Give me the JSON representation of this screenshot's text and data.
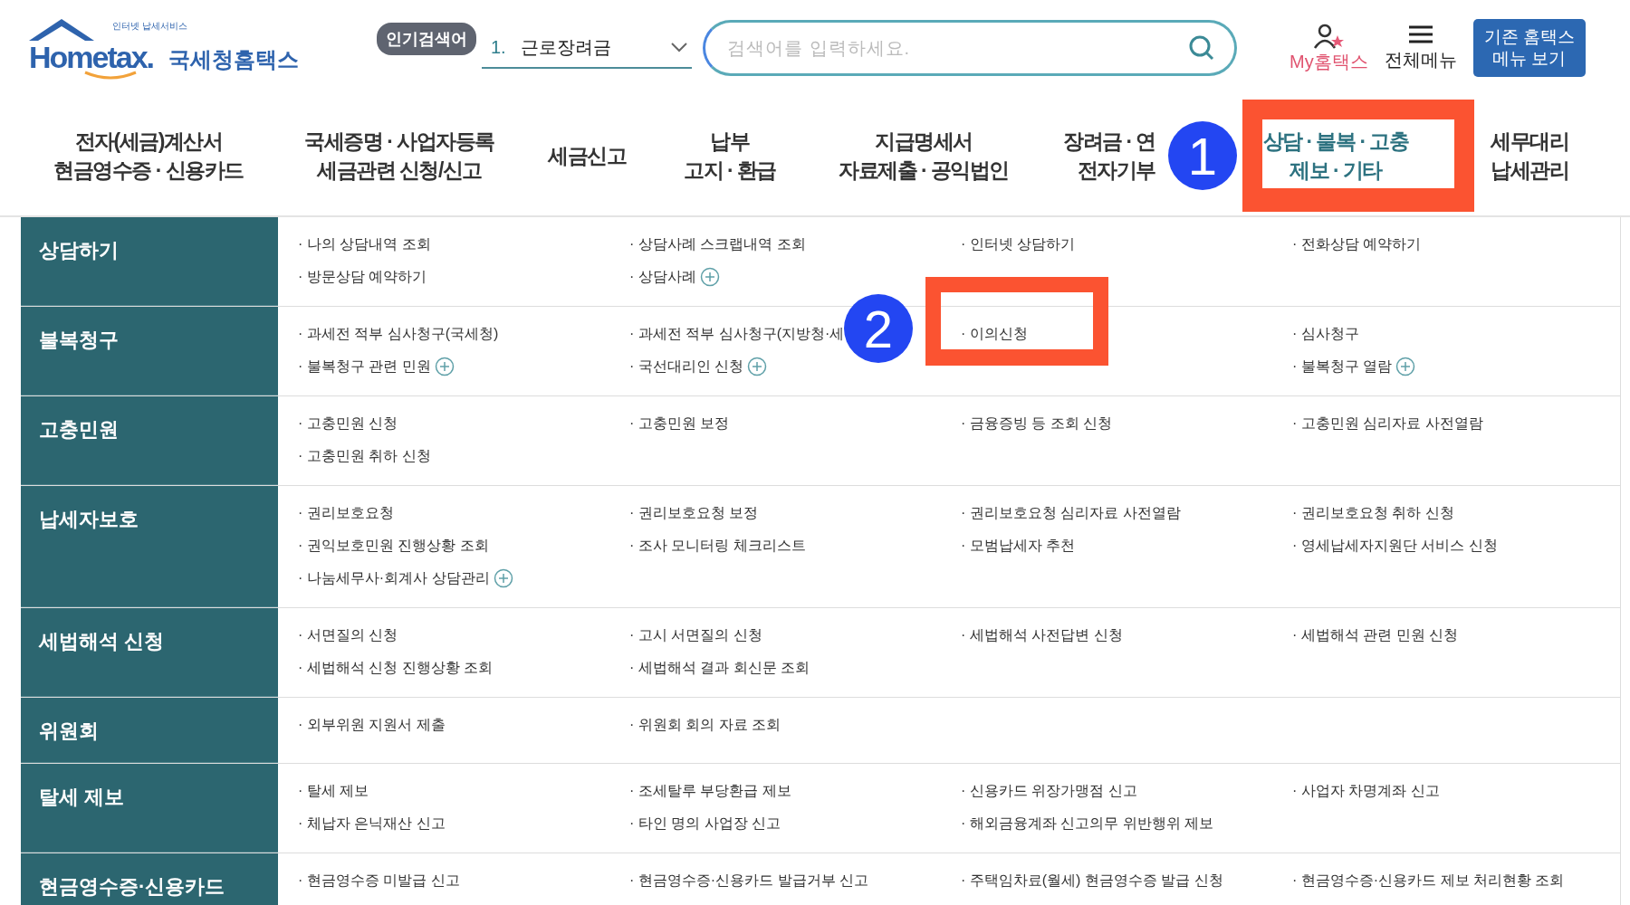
{
  "header": {
    "logo": {
      "tagline": "인터넷 납세서비스",
      "brand": "Hometax.",
      "name": "국세청홈택스"
    },
    "popular": {
      "label": "인기검색어",
      "rank": "1.",
      "keyword": "근로장려금"
    },
    "search": {
      "placeholder": "검색어를 입력하세요."
    },
    "my_hometax": "My홈택스",
    "all_menu": "전체메뉴",
    "legacy_button": [
      "기존 홈택스",
      "메뉴 보기"
    ]
  },
  "nav": [
    {
      "lines": [
        "전자(세금)계산서",
        "현금영수증 · 신용카드"
      ],
      "selected": false
    },
    {
      "lines": [
        "국세증명 · 사업자등록",
        "세금관련 신청/신고"
      ],
      "selected": false
    },
    {
      "lines": [
        "세금신고"
      ],
      "selected": false
    },
    {
      "lines": [
        "납부",
        "고지 · 환급"
      ],
      "selected": false
    },
    {
      "lines": [
        "지급명세서",
        "자료제출 · 공익법인"
      ],
      "selected": false
    },
    {
      "lines": [
        "장려금 · 연",
        "전자기부"
      ],
      "selected": false
    },
    {
      "lines": [
        "상담 · 불복 · 고충",
        "제보 · 기타"
      ],
      "selected": true
    },
    {
      "lines": [
        "세무대리",
        "납세관리"
      ],
      "selected": false
    }
  ],
  "categories": [
    {
      "title": "상담하기",
      "items": [
        {
          "kind": "link",
          "text": "· 나의 상담내역 조회",
          "plus": false
        },
        {
          "kind": "link",
          "text": "· 상담사례 스크랩내역 조회",
          "plus": false
        },
        {
          "kind": "link",
          "text": "· 인터넷 상담하기",
          "plus": false
        },
        {
          "kind": "link",
          "text": "· 전화상담 예약하기",
          "plus": false
        },
        {
          "kind": "link",
          "text": "· 방문상담 예약하기",
          "plus": false
        },
        {
          "kind": "link",
          "text": "· 상담사례",
          "plus": true
        }
      ]
    },
    {
      "title": "불복청구",
      "items": [
        {
          "kind": "link",
          "text": "· 과세전 적부 심사청구(국세청)",
          "plus": false
        },
        {
          "kind": "link",
          "text": "· 과세전 적부 심사청구(지방청·세",
          "plus": false
        },
        {
          "kind": "link",
          "text": "· 이의신청",
          "plus": false
        },
        {
          "kind": "link",
          "text": "· 심사청구",
          "plus": false
        },
        {
          "kind": "link",
          "text": "· 불복청구 관련 민원",
          "plus": true
        },
        {
          "kind": "link",
          "text": "· 국선대리인 신청",
          "plus": true
        },
        {
          "kind": "covered"
        },
        {
          "kind": "link",
          "text": "· 불복청구 열람",
          "plus": true
        }
      ]
    },
    {
      "title": "고충민원",
      "items": [
        {
          "kind": "link",
          "text": "· 고충민원 신청",
          "plus": false
        },
        {
          "kind": "link",
          "text": "· 고충민원 보정",
          "plus": false
        },
        {
          "kind": "link",
          "text": "· 금융증빙 등 조회 신청",
          "plus": false
        },
        {
          "kind": "link",
          "text": "· 고충민원 심리자료 사전열람",
          "plus": false
        },
        {
          "kind": "link",
          "text": "· 고충민원 취하 신청",
          "plus": false
        }
      ]
    },
    {
      "title": "납세자보호",
      "items": [
        {
          "kind": "link",
          "text": "· 권리보호요청",
          "plus": false
        },
        {
          "kind": "link",
          "text": "· 권리보호요청 보정",
          "plus": false
        },
        {
          "kind": "link",
          "text": "· 권리보호요청 심리자료 사전열람",
          "plus": false
        },
        {
          "kind": "link",
          "text": "· 권리보호요청 취하 신청",
          "plus": false
        },
        {
          "kind": "link",
          "text": "· 권익보호민원 진행상황 조회",
          "plus": false
        },
        {
          "kind": "link",
          "text": "· 조사 모니터링 체크리스트",
          "plus": false
        },
        {
          "kind": "link",
          "text": "· 모범납세자 추천",
          "plus": false
        },
        {
          "kind": "link",
          "text": "· 영세납세자지원단 서비스 신청",
          "plus": false
        },
        {
          "kind": "link",
          "text": "· 나눔세무사·회계사 상담관리",
          "plus": true
        }
      ]
    },
    {
      "title": "세법해석 신청",
      "items": [
        {
          "kind": "link",
          "text": "· 서면질의 신청",
          "plus": false
        },
        {
          "kind": "link",
          "text": "· 고시 서면질의 신청",
          "plus": false
        },
        {
          "kind": "link",
          "text": "· 세법해석 사전답변 신청",
          "plus": false
        },
        {
          "kind": "link",
          "text": "· 세법해석 관련 민원 신청",
          "plus": false
        },
        {
          "kind": "link",
          "text": "· 세법해석 신청 진행상황 조회",
          "plus": false
        },
        {
          "kind": "link",
          "text": "· 세법해석 결과 회신문 조회",
          "plus": false
        }
      ]
    },
    {
      "title": "위원회",
      "items": [
        {
          "kind": "link",
          "text": "· 외부위원 지원서 제출",
          "plus": false
        },
        {
          "kind": "link",
          "text": "· 위원회 회의 자료 조회",
          "plus": false
        }
      ]
    },
    {
      "title": "탈세 제보",
      "items": [
        {
          "kind": "link",
          "text": "· 탈세 제보",
          "plus": false
        },
        {
          "kind": "link",
          "text": "· 조세탈루 부당환급 제보",
          "plus": false
        },
        {
          "kind": "link",
          "text": "· 신용카드 위장가맹점 신고",
          "plus": false
        },
        {
          "kind": "link",
          "text": "· 사업자 차명계좌 신고",
          "plus": false
        },
        {
          "kind": "link",
          "text": "· 체납자 은닉재산 신고",
          "plus": false
        },
        {
          "kind": "link",
          "text": "· 타인 명의 사업장 신고",
          "plus": false
        },
        {
          "kind": "link",
          "text": "· 해외금융계좌 신고의무 위반행위 제보",
          "plus": false
        }
      ]
    },
    {
      "title": "현금영수증·신용카드",
      "items": [
        {
          "kind": "link",
          "text": "· 현금영수증 미발급 신고",
          "plus": false
        },
        {
          "kind": "link",
          "text": "· 현금영수증·신용카드 발급거부 신고",
          "plus": false
        },
        {
          "kind": "link",
          "text": "· 주택임차료(월세) 현금영수증 발급 신청",
          "plus": false
        },
        {
          "kind": "link",
          "text": "· 현금영수증·신용카드 제보 처리현황 조회",
          "plus": false
        }
      ]
    }
  ],
  "annotations": [
    {
      "number": "1"
    },
    {
      "number": "2"
    }
  ]
}
